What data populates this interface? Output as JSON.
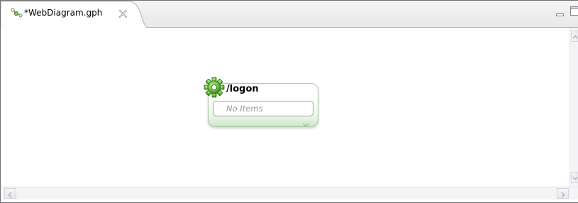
{
  "editor": {
    "tab_title": "*WebDiagram.gph",
    "tab_icon": "diagram-file-icon",
    "close_icon": "close-icon",
    "minimize_icon": "minimize-icon",
    "maximize_icon": "maximize-icon"
  },
  "diagram": {
    "node": {
      "title": "/logon",
      "icon": "gear-icon",
      "items_placeholder": "No Items"
    }
  },
  "scrollbars": {
    "vertical": [
      "scroll-up-icon",
      "scroll-down-icon"
    ],
    "horizontal": [
      "scroll-left-icon",
      "scroll-right-icon"
    ]
  },
  "colors": {
    "node_accent": "#cfe5c9",
    "node_border": "#a7c5a1",
    "gear": "#5aaa3c"
  }
}
